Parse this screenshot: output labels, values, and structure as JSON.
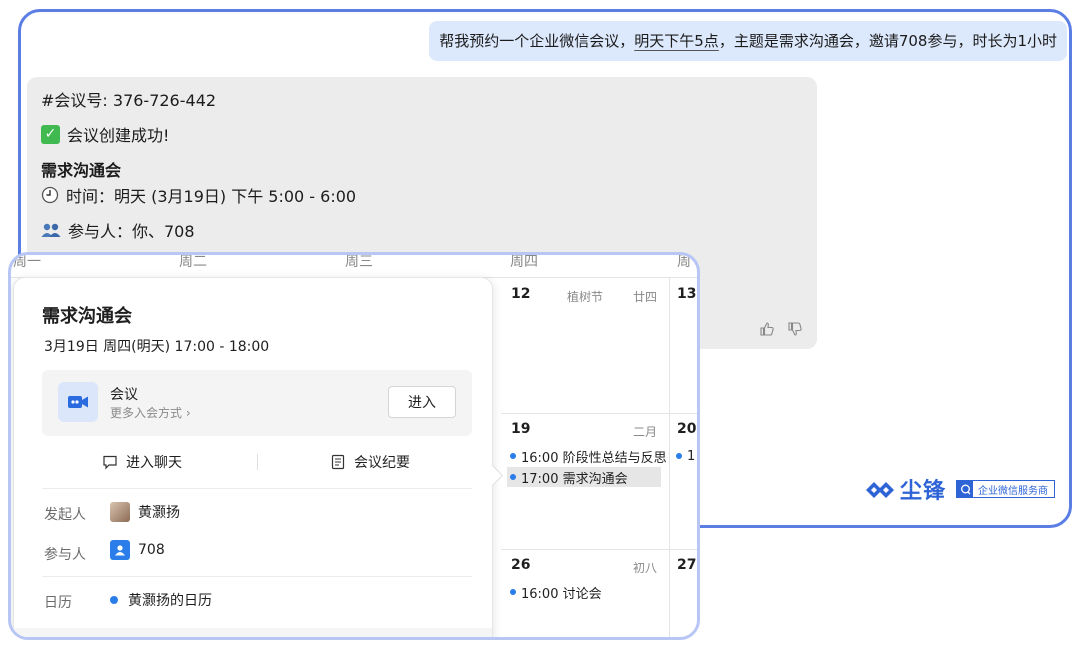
{
  "chat": {
    "user_message_pre": "帮我预约一个企业微信会议，",
    "user_message_ul": "明天下午5点",
    "user_message_post": "，主题是需求沟通会，邀请708参与，时长为1小时",
    "bot": {
      "meeting_id_line": "#会议号: 376-726-442",
      "success_line": "会议创建成功!",
      "meeting_title": "需求沟通会",
      "time_line": "时间：明天 (3月19日) 下午 5:00 - 6:00",
      "participants_line": "参与人：你、708"
    }
  },
  "brand": {
    "name": "尘锋",
    "tag": "企业微信服务商",
    "color": "#2e64d6"
  },
  "calendar": {
    "headers": [
      "周一",
      "周二",
      "周三",
      "周四",
      "周"
    ],
    "days": {
      "d12": "12",
      "d12_note1": "植树节",
      "d12_note2": "廿四",
      "d13": "13",
      "d19": "19",
      "d19_note": "二月",
      "d20": "20",
      "d26": "26",
      "d26_note": "初八",
      "d27": "27"
    },
    "events": {
      "e19_1": "16:00 阶段性总结与反思",
      "e19_2": "17:00 需求沟通会",
      "e20_1": "1",
      "e26_1": "16:00 讨论会"
    }
  },
  "popover": {
    "title": "需求沟通会",
    "time": "3月19日 周四(明天) 17:00 - 18:00",
    "meeting_label": "会议",
    "meeting_more": "更多入会方式 ›",
    "enter_button": "进入",
    "chat_action": "进入聊天",
    "minutes_action": "会议纪要",
    "organizer_label": "发起人",
    "organizer_name": "黄灏扬",
    "participants_label": "参与人",
    "participants_value": "708",
    "calendar_label": "日历",
    "calendar_value": "黄灏扬的日历"
  }
}
